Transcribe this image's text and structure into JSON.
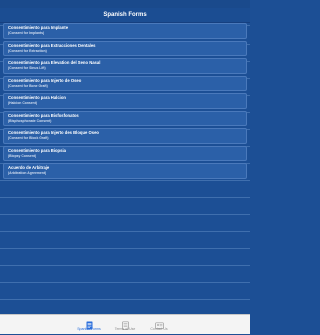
{
  "nav": {
    "title": "Spanish Forms"
  },
  "forms": [
    {
      "title": "Consentimiento para Implante",
      "subtitle": "(Consent for Implants)"
    },
    {
      "title": "Consentimiento para Extracciones Dentales",
      "subtitle": "(Consent for Extraction)"
    },
    {
      "title": "Consentimiento para Elevation del Seno Nasal",
      "subtitle": "(Consent for Sinus Lift)"
    },
    {
      "title": "Consentimiento para Injerto de Oseo",
      "subtitle": "(Consent for Bone Graft)"
    },
    {
      "title": "Consentimiento para Halcion",
      "subtitle": "(Halcion Consent)"
    },
    {
      "title": "Consentimiento para Bisfosfonatos",
      "subtitle": "(Bisphosphonate Consent)"
    },
    {
      "title": "Consentimiento para Injerto des Bloque Oseo",
      "subtitle": "(Consent for Block Graft)"
    },
    {
      "title": "Consentimiento para Biopsia",
      "subtitle": "(Biopsy Consent)"
    },
    {
      "title": "Acuerdo de Arbitraje",
      "subtitle": "(Arbitration Agreement)"
    }
  ],
  "tabs": [
    {
      "label": "Spanish Forms",
      "icon": "document-icon",
      "active": true
    },
    {
      "label": "Terms of Use",
      "icon": "terms-icon",
      "active": false
    },
    {
      "label": "Contact Us",
      "icon": "contact-card-icon",
      "active": false
    }
  ],
  "colors": {
    "background": "#1c4f95",
    "row": "#2b60a8",
    "active_tab": "#2a6edb",
    "inactive_tab": "#8e8e8e"
  }
}
